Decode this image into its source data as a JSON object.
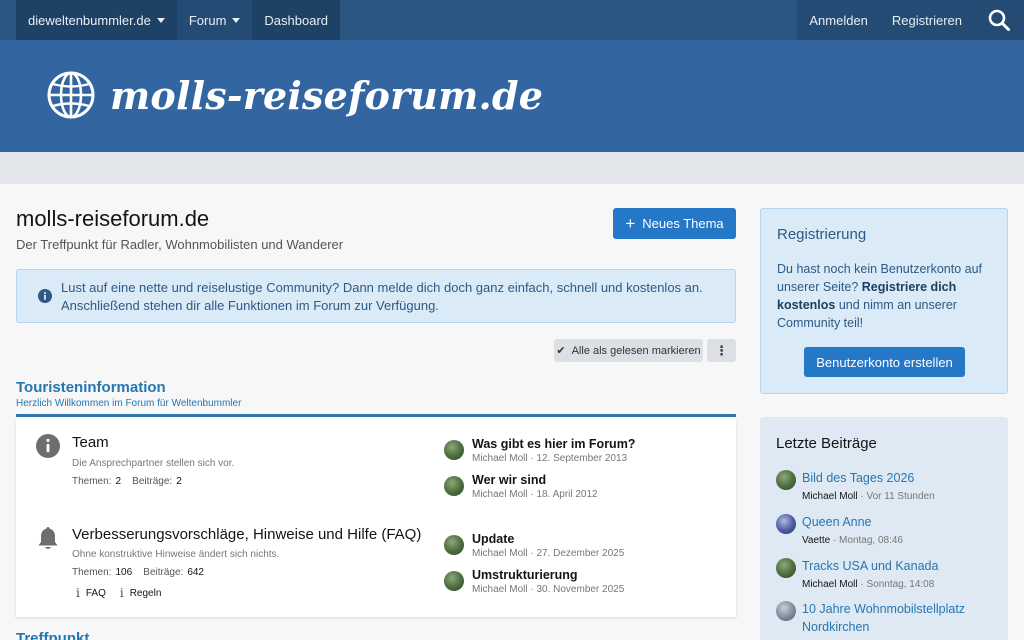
{
  "nav": {
    "site_label": "dieweltenbummler.de",
    "forum_label": "Forum",
    "dashboard_label": "Dashboard",
    "login_label": "Anmelden",
    "register_label": "Registrieren"
  },
  "banner": {
    "logo_text": "molls-reiseforum.de"
  },
  "page": {
    "title": "molls-reiseforum.de",
    "description": "Der Treffpunkt für Radler, Wohnmobilisten und Wanderer",
    "new_thread_label": "Neues Thema",
    "notice_text": "Lust auf eine nette und reiselustige Community? Dann melde dich doch ganz einfach, schnell und kostenlos an. Anschließend stehen dir alle Funktionen im Forum zur Verfügung.",
    "mark_read_label": "Alle als gelesen markieren",
    "more_label": "⋮"
  },
  "category": {
    "title": "Touristeninformation",
    "description": "Herzlich Willkommen im Forum für Weltenbummler",
    "next_title": "Treffpunkt"
  },
  "forums": [
    {
      "name": "Team",
      "description": "Die Ansprechpartner stellen sich vor.",
      "threads_label": "Themen:",
      "threads": "2",
      "posts_label": "Beiträge:",
      "posts": "2",
      "latest": [
        {
          "title": "Was gibt es hier im Forum?",
          "meta": "Michael Moll · 12. September 2013"
        },
        {
          "title": "Wer wir sind",
          "meta": "Michael Moll · 18. April 2012"
        }
      ]
    },
    {
      "name": "Verbesserungsvorschläge, Hinweise und Hilfe (FAQ)",
      "description": "Ohne konstruktive Hinweise ändert sich nichts.",
      "threads_label": "Themen:",
      "threads": "106",
      "posts_label": "Beiträge:",
      "posts": "642",
      "links": [
        "FAQ",
        "Regeln"
      ],
      "latest": [
        {
          "title": "Update",
          "meta": "Michael Moll · 27. Dezember 2025"
        },
        {
          "title": "Umstrukturierung",
          "meta": "Michael Moll · 30. November 2025"
        }
      ]
    }
  ],
  "sidebar": {
    "register": {
      "title": "Registrierung",
      "text_before": "Du hast noch kein Benutzerkonto auf unserer Seite? ",
      "text_bold": "Registriere dich kostenlos",
      "text_after": " und nimm an unserer Community teil!",
      "button_label": "Benutzerkonto erstellen"
    },
    "latest_posts": {
      "title": "Letzte Beiträge",
      "items": [
        {
          "title": "Bild des Tages 2026",
          "author": "Michael Moll",
          "time": " · Vor 11 Stunden"
        },
        {
          "title": "Queen Anne",
          "author": "Vaette",
          "time": " · Montag, 08:46"
        },
        {
          "title": "Tracks USA und Kanada",
          "author": "Michael Moll",
          "time": " · Sonntag, 14:08"
        },
        {
          "title": "10 Jahre Wohnmobilstellplatz Nordkirchen",
          "author": "",
          "time": ""
        }
      ]
    }
  },
  "colors": {
    "nav_bg": "#2a5681",
    "banner_bg": "#3366a0",
    "accent": "#2577c8",
    "link": "#2577b1"
  }
}
